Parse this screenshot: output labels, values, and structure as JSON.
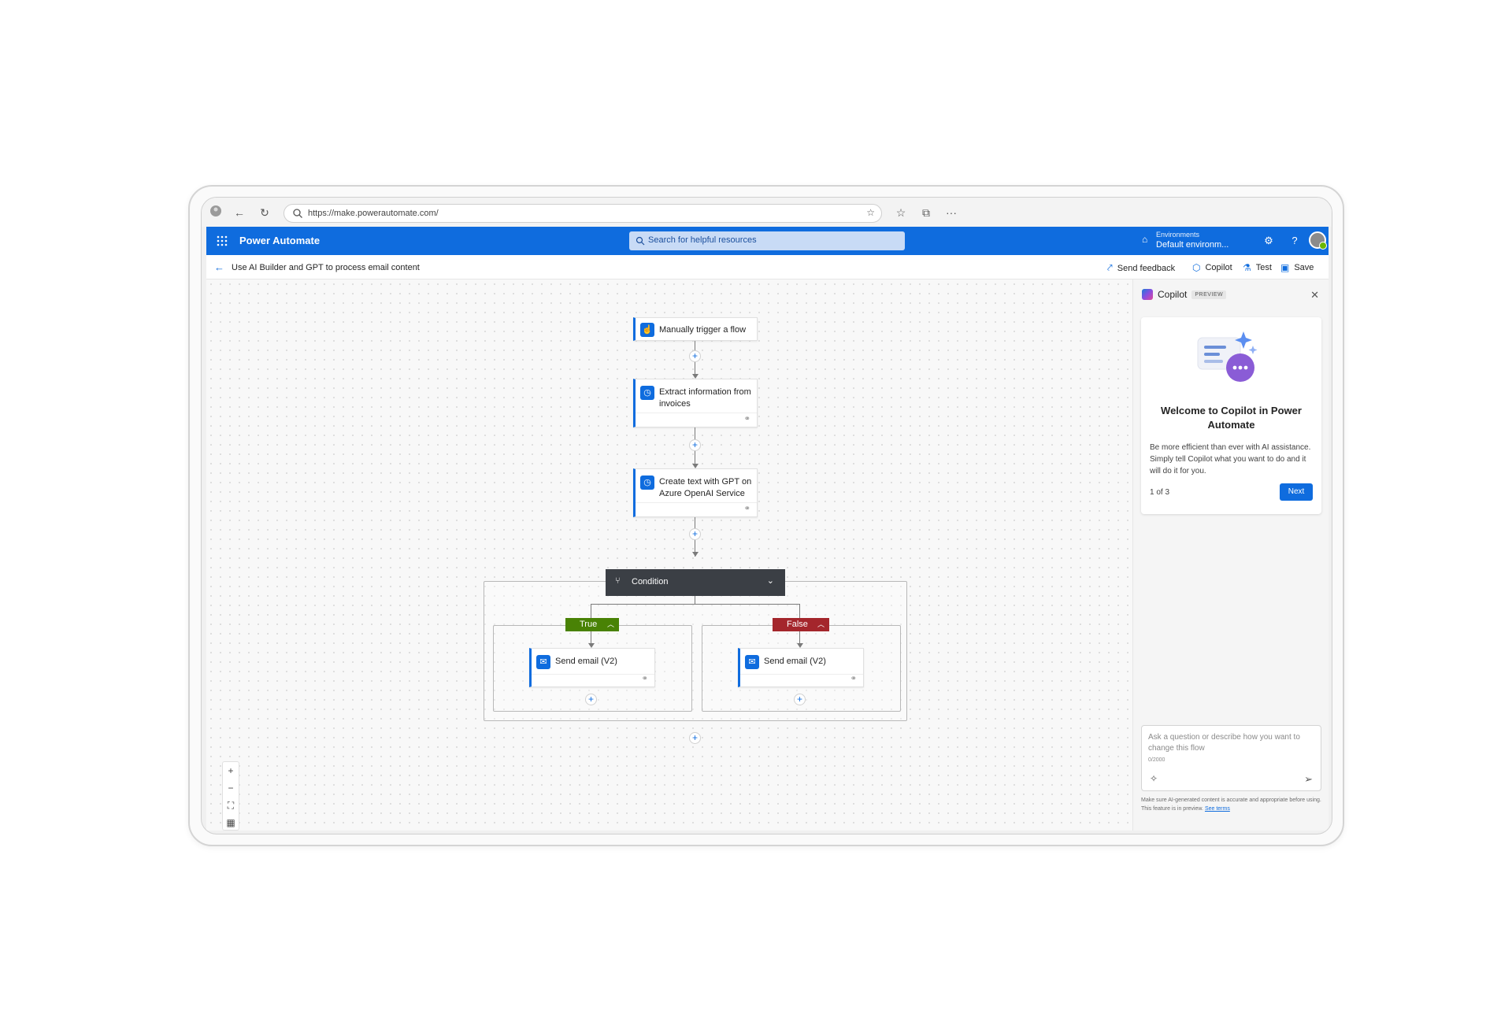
{
  "browser": {
    "url": "https://make.powerautomate.com/"
  },
  "app": {
    "title": "Power Automate",
    "search_placeholder": "Search for helpful resources",
    "environment_label": "Environments",
    "environment_value": "Default environm..."
  },
  "commandbar": {
    "flow_name": "Use AI Builder and GPT to process email content",
    "send_feedback": "Send feedback",
    "copilot": "Copilot",
    "test": "Test",
    "save": "Save"
  },
  "flow": {
    "trigger": "Manually trigger a flow",
    "step1": "Extract information from invoices",
    "step2": "Create text with GPT on Azure OpenAI Service",
    "condition": "Condition",
    "true_label": "True",
    "false_label": "False",
    "true_action": "Send email (V2)",
    "false_action": "Send email (V2)"
  },
  "copilot": {
    "title": "Copilot",
    "badge": "PREVIEW",
    "welcome_title": "Welcome to Copilot in Power Automate",
    "welcome_desc": "Be more efficient than ever with AI assistance. Simply tell Copilot what you want to do and it will do it for you.",
    "pager": "1 of 3",
    "next": "Next",
    "input_placeholder": "Ask a question or describe how you want to change this flow",
    "char_count": "0/2000",
    "disclaimer": "Make sure AI-generated content is accurate and appropriate before using. This feature is in preview.",
    "see_terms": "See terms"
  },
  "colors": {
    "brand": "#0f6cde",
    "true": "#498205",
    "false": "#a4262c",
    "condition": "#3b3f45"
  }
}
